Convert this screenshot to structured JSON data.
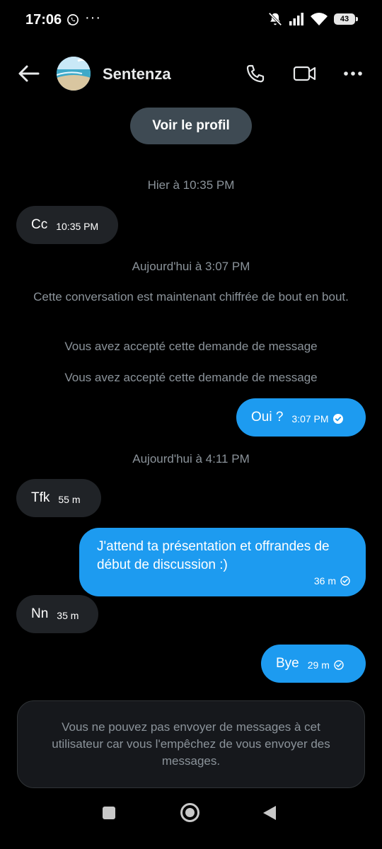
{
  "status_bar": {
    "time": "17:06",
    "dots": "···",
    "battery": "43"
  },
  "header": {
    "name": "Sentenza",
    "profile_button": "Voir le profil",
    "icons": [
      "back-arrow-icon",
      "phone-icon",
      "video-icon",
      "more-icon"
    ]
  },
  "messages": {
    "sep1": "Hier à 10:35 PM",
    "m1": {
      "text": "Cc",
      "time": "10:35 PM"
    },
    "sep2": "Aujourd'hui à 3:07 PM",
    "notice1": "Cette conversation est maintenant chiffrée de bout en bout.",
    "notice2": "Vous avez accepté cette demande de message",
    "notice3": "Vous avez accepté cette demande de message",
    "m2": {
      "text": "Oui ?",
      "time": "3:07 PM"
    },
    "sep3": "Aujourd'hui à 4:11 PM",
    "m3": {
      "text": "Tfk",
      "time": "55 m"
    },
    "m4": {
      "text": "J'attend ta présentation et offrandes de début de discussion :)",
      "time": "36 m"
    },
    "m5": {
      "text": "Nn",
      "time": "35 m"
    },
    "m6": {
      "text": "Bye",
      "time": "29 m"
    }
  },
  "blocked_notice": "Vous ne pouvez pas envoyer de messages à cet utilisateur car vous l'empêchez de vous envoyer des messages.",
  "colors": {
    "accent": "#1d9bf0",
    "incoming_bubble": "#202327",
    "background": "#000000"
  }
}
